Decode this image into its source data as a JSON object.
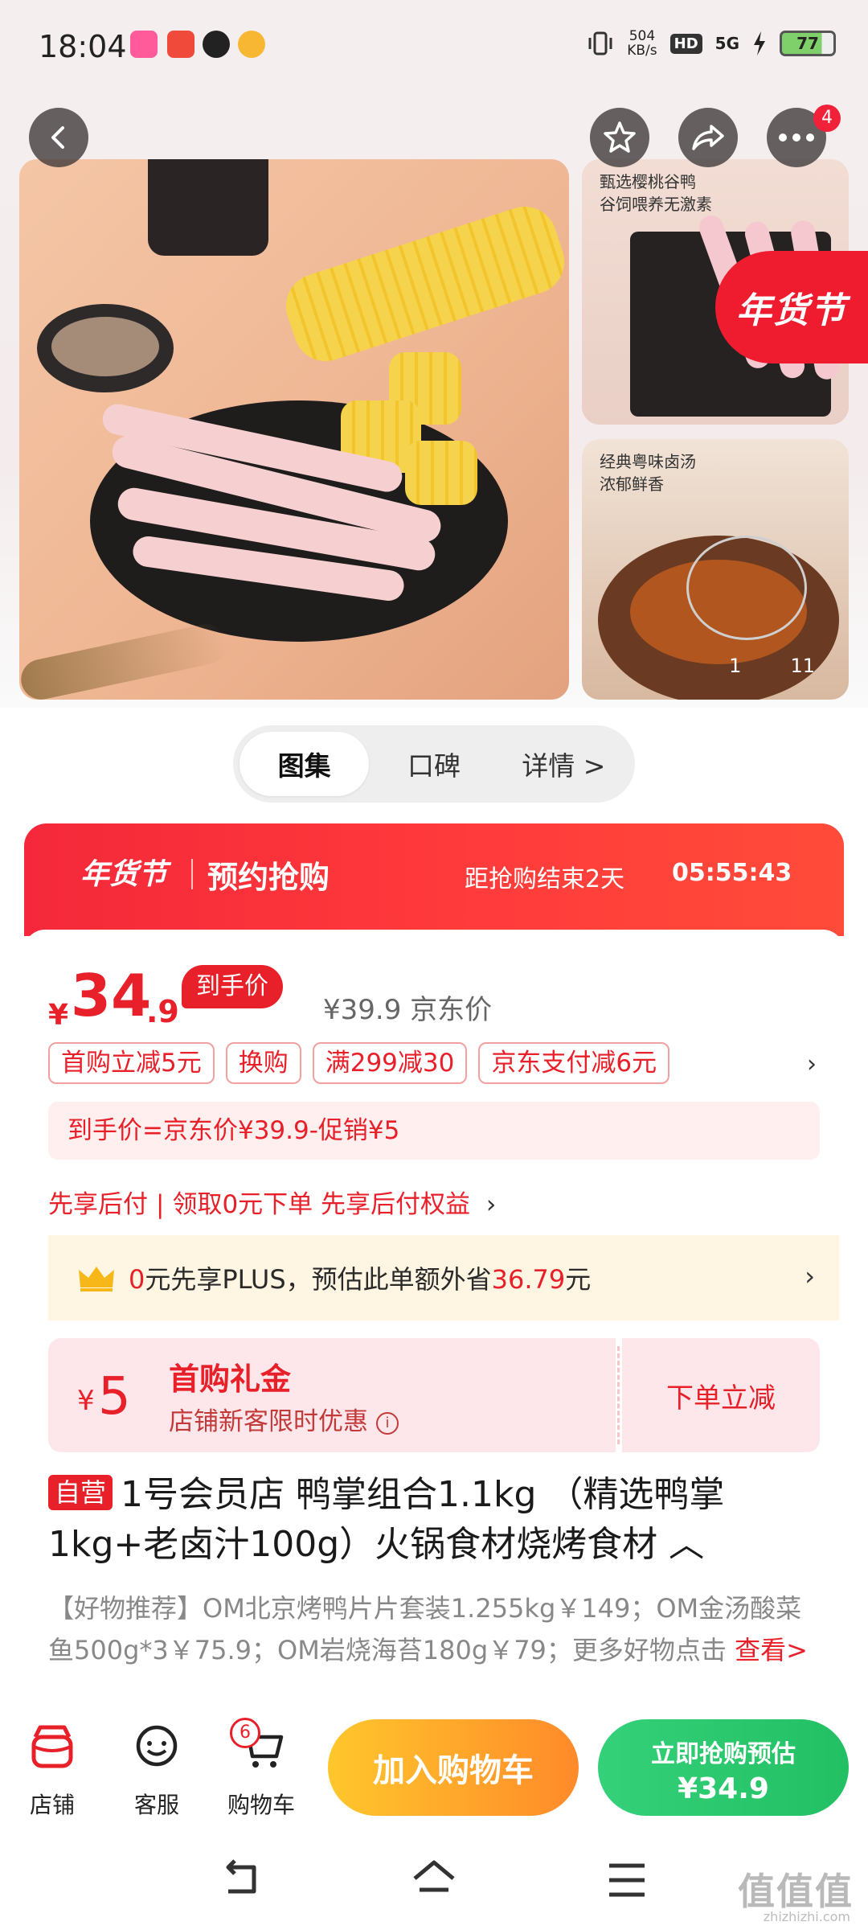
{
  "status_bar": {
    "time": "18:04",
    "net_speed_top": "504",
    "net_speed_bottom": "KB/s",
    "hd": "HD",
    "signal": "5G",
    "battery": "77"
  },
  "gallery": {
    "side1_text": "甄选樱桃谷鸭\n谷饲喂养无激素",
    "side2_text": "经典粤味卤汤\n浓郁鲜香",
    "festival_badge": "年货节",
    "pager_current": "1",
    "pager_total": "11",
    "more_badge_count": "4"
  },
  "tabs": [
    {
      "label": "图集"
    },
    {
      "label": "口碑"
    },
    {
      "label": "详情 >"
    }
  ],
  "promo": {
    "festival": "年货节",
    "title": "预约抢购",
    "countdown_label": "距抢购结束2天",
    "countdown": "05:55:43"
  },
  "price": {
    "yen": "¥",
    "integer": "34",
    "decimal": ".9",
    "tag": "到手价",
    "jd_price": "¥39.9 京东价"
  },
  "chips": [
    "首购立减5元",
    "换购",
    "满299减30",
    "京东支付减6元"
  ],
  "chips_arrow": "›",
  "formula": "到手价=京东价¥39.9-促销¥5",
  "paylater": {
    "left": "先享后付",
    "sep": "|",
    "right": "领取0元下单 先享后付权益",
    "arrow": "›"
  },
  "plus": {
    "pre": "0",
    "mid": "元先享PLUS，预估此单额外省",
    "amount": "36.79",
    "post": "元",
    "arrow": "›"
  },
  "coupon": {
    "yen": "¥",
    "amount": "5",
    "title": "首购礼金",
    "subtitle": "店铺新客限时优惠",
    "info": "i",
    "action": "下单立减"
  },
  "product": {
    "tag": "自营",
    "title": "1号会员店 鸭掌组合1.1kg （精选鸭掌1kg+老卤汁100g）火锅食材烧烤食材 ︿"
  },
  "recommend": {
    "text": "【好物推荐】OM北京烤鸭片片套装1.255kg￥149；OM金汤酸菜鱼500g*3￥75.9；OM岩烧海苔180g￥79；更多好物点击 ",
    "link": "查看>"
  },
  "action_bar": {
    "store": "店铺",
    "service": "客服",
    "cart": "购物车",
    "cart_count": "6",
    "add_cart": "加入购物车",
    "buy_line1": "立即抢购预估",
    "buy_line2": "¥34.9"
  },
  "watermark": {
    "logo": "值值值",
    "site": "zhizhizhi.com"
  },
  "colors": {
    "primary_red": "#e8202a",
    "buy_green": "#22bf63",
    "cart_orange": "#ff8a2a"
  }
}
